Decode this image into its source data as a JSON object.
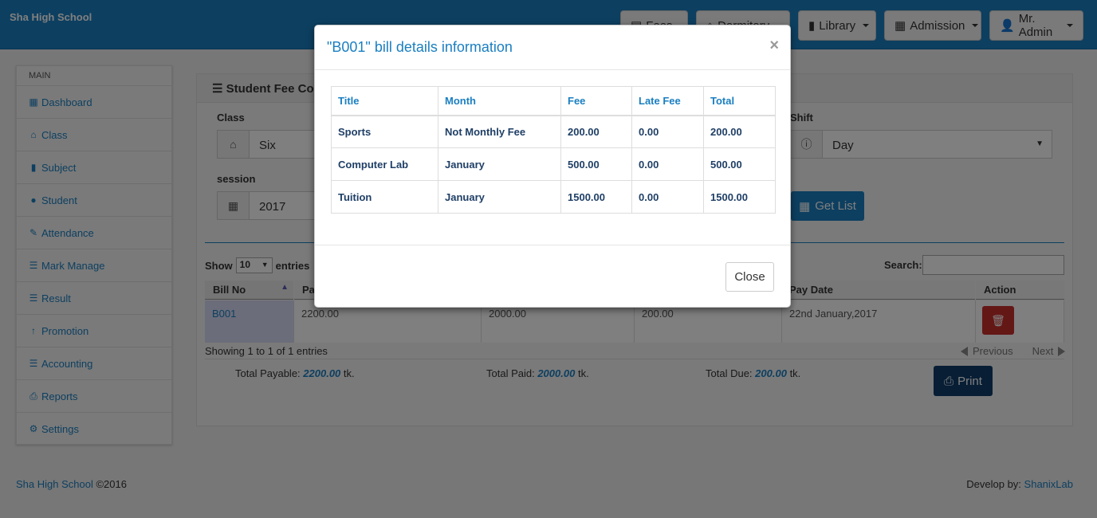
{
  "app": {
    "brand": "Sha High School"
  },
  "nav": {
    "items": [
      {
        "label": "Fees",
        "icon": "money-icon"
      },
      {
        "label": "Dormitory",
        "icon": "home-icon"
      },
      {
        "label": "Library",
        "icon": "book-icon"
      },
      {
        "label": "Admission",
        "icon": "grid-icon"
      },
      {
        "label": "Mr. Admin",
        "icon": "user-icon"
      }
    ]
  },
  "sidebar": {
    "heading": "MAIN",
    "items": [
      {
        "label": "Dashboard",
        "icon": "dashboard-icon"
      },
      {
        "label": "Class",
        "icon": "home-icon"
      },
      {
        "label": "Subject",
        "icon": "book-icon"
      },
      {
        "label": "Student",
        "icon": "user-icon"
      },
      {
        "label": "Attendance",
        "icon": "pencil-icon"
      },
      {
        "label": "Mark Manage",
        "icon": "list-icon"
      },
      {
        "label": "Result",
        "icon": "list-icon"
      },
      {
        "label": "Promotion",
        "icon": "arrow-up-icon"
      },
      {
        "label": "Accounting",
        "icon": "list-icon"
      },
      {
        "label": "Reports",
        "icon": "print-icon"
      },
      {
        "label": "Settings",
        "icon": "gear-icon"
      }
    ]
  },
  "panel": {
    "title": "Student Fee Co",
    "class_label": "Class",
    "class_value": "Six",
    "session_label": "session",
    "session_value": "2017",
    "shift_label": "Shift",
    "shift_value": "Day",
    "get_list_label": "Get List"
  },
  "table": {
    "show_label": "Show",
    "show_value": "10",
    "entries_label": "entries",
    "search_label": "Search:",
    "headers": {
      "bill_no": "Bill No",
      "payable": "Pa",
      "pay_date": "Pay Date",
      "action": "Action"
    },
    "row": {
      "bill_no": "B001",
      "payable": "2200.00",
      "paid": "2000.00",
      "due": "200.00",
      "pay_date": "22nd January,2017"
    },
    "info": "Showing 1 to 1 of 1 entries",
    "previous": "Previous",
    "next": "Next"
  },
  "totals": {
    "payable_label": "Total Payable:",
    "payable_value": "2200.00",
    "paid_label": "Total Paid:",
    "paid_value": "2000.00",
    "due_label": "Total Due:",
    "due_value": "200.00",
    "unit": "tk.",
    "print_label": "Print"
  },
  "footer": {
    "school": "Sha High School",
    "copyright": "©2016",
    "develop_label": "Develop by:",
    "developer": "ShanixLab"
  },
  "modal": {
    "title": "\"B001\" bill details information",
    "close_x": "×",
    "close_label": "Close",
    "headers": [
      "Title",
      "Month",
      "Fee",
      "Late Fee",
      "Total"
    ],
    "rows": [
      [
        "Sports",
        "Not Monthly Fee",
        "200.00",
        "0.00",
        "200.00"
      ],
      [
        "Computer Lab",
        "January",
        "500.00",
        "0.00",
        "500.00"
      ],
      [
        "Tuition",
        "January",
        "1500.00",
        "0.00",
        "1500.00"
      ]
    ]
  },
  "colors": {
    "primary": "#1a7fc1",
    "danger": "#c9302c",
    "dark_button": "#0f3d6a"
  }
}
